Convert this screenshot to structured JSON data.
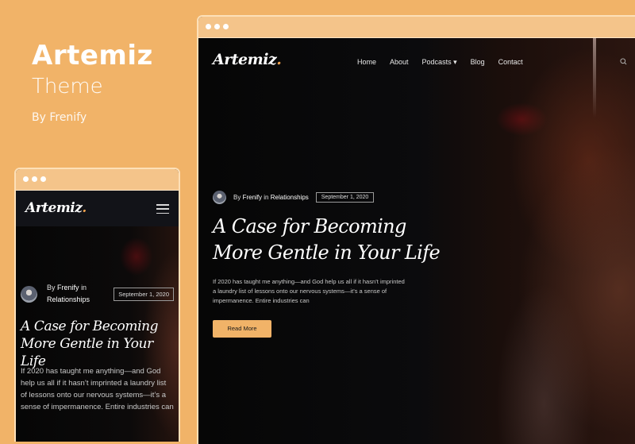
{
  "promo": {
    "brand": "Artemiz",
    "subtitle": "Theme",
    "author": "By Frenify"
  },
  "colors": {
    "background": "#f1b368",
    "accent": "#f1b368",
    "site_bg": "#0a0a0b"
  },
  "desktop": {
    "logo": "Artemiz",
    "logo_dot": ".",
    "nav": [
      "Home",
      "About",
      "Podcasts ▾",
      "Blog",
      "Contact"
    ],
    "search_icon": "search-icon",
    "post": {
      "by": "By",
      "author": "Frenify",
      "in": "in",
      "category": "Relationships",
      "date": "September 1, 2020",
      "title": "A Case for Becoming More Gentle in Your Life",
      "excerpt": "If 2020 has taught me anything—and God help us all if it hasn’t imprinted a laundry list of lessons onto our nervous systems—it’s a sense of impermanence. Entire industries can",
      "button": "Read More"
    }
  },
  "mobile": {
    "logo": "Artemiz",
    "logo_dot": ".",
    "menu_icon": "hamburger-icon",
    "post": {
      "by": "By",
      "author": "Frenify",
      "in": "in",
      "category": "Relationships",
      "date": "September 1, 2020",
      "title": "A Case for Becoming More Gentle in Your Life",
      "excerpt": "If 2020 has taught me anything—and God help us all if it hasn’t imprinted a laundry list of lessons onto our nervous systems—it’s a sense of impermanence. Entire industries can"
    }
  }
}
